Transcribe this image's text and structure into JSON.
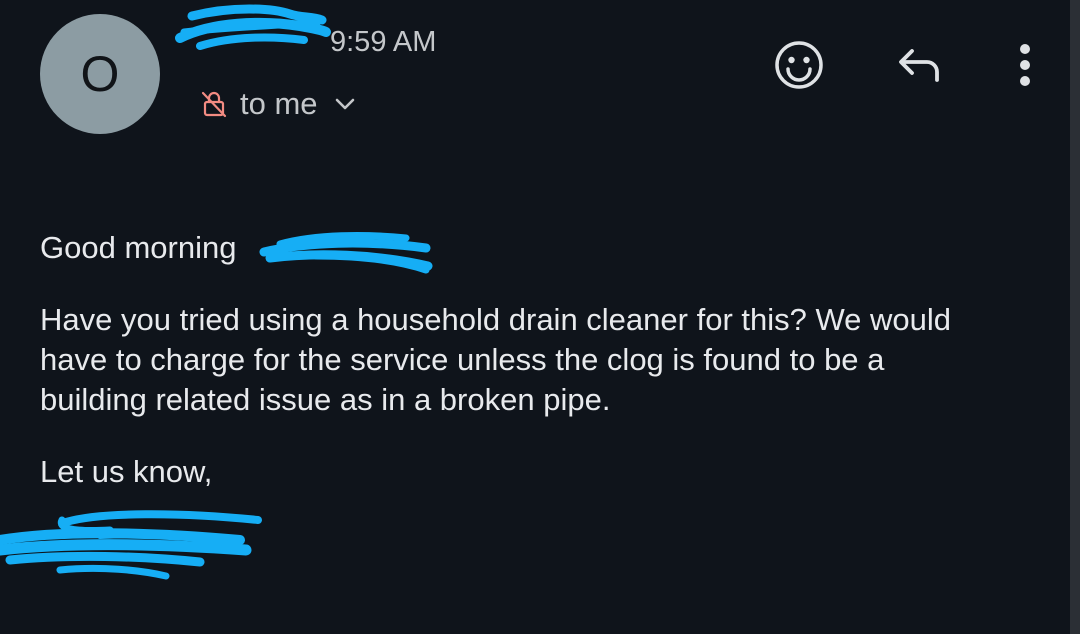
{
  "header": {
    "avatar_letter": "O",
    "sender_name": "",
    "time": "9:59 AM",
    "recipient": "to me"
  },
  "toolbar": {
    "emoji_icon": "emoji-react-icon",
    "reply_icon": "reply-icon",
    "more_icon": "more-vert-icon"
  },
  "message": {
    "greeting": "Good morning",
    "line1": "Have you tried using a household drain cleaner for this? We would",
    "line2": "have to charge for the service unless the clog is found to be a",
    "line3": "building related issue as in a broken pipe.",
    "signoff": "Let us know,"
  },
  "colors": {
    "background": "#0f141b",
    "avatar": "#8c9ca3",
    "redaction": "#16aef5",
    "warning_icon": "#f28b82"
  }
}
